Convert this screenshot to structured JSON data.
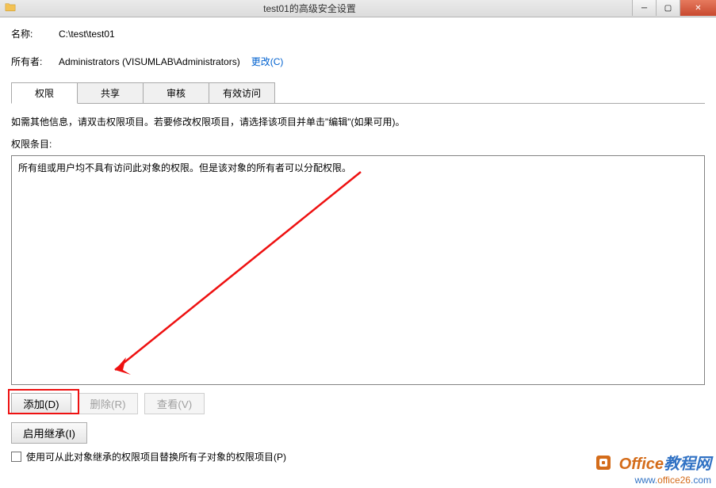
{
  "titlebar": {
    "title": "test01的高级安全设置"
  },
  "fields": {
    "name_label": "名称:",
    "name_value": "C:\\test\\test01",
    "owner_label": "所有者:",
    "owner_value": "Administrators (VISUMLAB\\Administrators)",
    "change_link": "更改(C)"
  },
  "tabs": {
    "permissions": "权限",
    "share": "共享",
    "audit": "审核",
    "effective": "有效访问"
  },
  "body": {
    "info": "如需其他信息，请双击权限项目。若要修改权限项目，请选择该项目并单击\"编辑\"(如果可用)。",
    "list_label": "权限条目:",
    "empty_text": "所有组或用户均不具有访问此对象的权限。但是该对象的所有者可以分配权限。"
  },
  "buttons": {
    "add": "添加(D)",
    "remove": "删除(R)",
    "view": "查看(V)",
    "enable_inherit": "启用继承(I)"
  },
  "checkbox": {
    "replace_label": "使用可从此对象继承的权限项目替换所有子对象的权限项目(P)"
  },
  "watermark": {
    "top_prefix": "Office",
    "top_suffix": "教程网",
    "bottom_prefix": "www.",
    "bottom_mid": "office26",
    "bottom_suffix": ".com"
  }
}
